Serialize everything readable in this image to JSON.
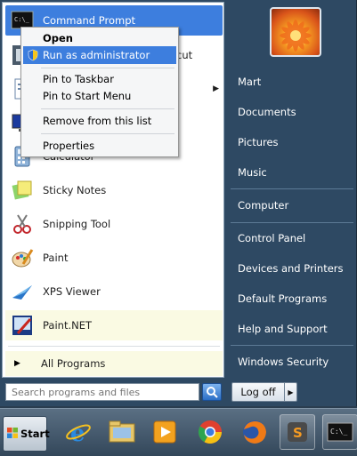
{
  "programs": [
    {
      "label": "Command Prompt",
      "icon": "command-prompt-icon"
    },
    {
      "label": "cut",
      "icon": "shortcut-icon"
    },
    {
      "label": "",
      "icon": "document-icon"
    },
    {
      "label": "",
      "icon": "monitor-icon"
    },
    {
      "label": "Calculator",
      "icon": "calculator-icon"
    },
    {
      "label": "Sticky Notes",
      "icon": "sticky-notes-icon"
    },
    {
      "label": "Snipping Tool",
      "icon": "snipping-tool-icon"
    },
    {
      "label": "Paint",
      "icon": "paint-icon"
    },
    {
      "label": "XPS Viewer",
      "icon": "xps-viewer-icon"
    },
    {
      "label": "Paint.NET",
      "icon": "paintnet-icon"
    }
  ],
  "all_programs": "All Programs",
  "search": {
    "placeholder": "Search programs and files"
  },
  "right": {
    "items": [
      "Mart",
      "Documents",
      "Pictures",
      "Music",
      "Computer",
      "Control Panel",
      "Devices and Printers",
      "Default Programs",
      "Help and Support",
      "Windows Security"
    ]
  },
  "log_off": "Log off",
  "context_menu": {
    "items": [
      "Open",
      "Run as administrator",
      "Pin to Taskbar",
      "Pin to Start Menu",
      "Remove from this list",
      "Properties"
    ]
  },
  "taskbar": {
    "start_label": "Start",
    "apps": [
      "internet-explorer-icon",
      "windows-explorer-icon",
      "media-player-icon",
      "chrome-icon",
      "firefox-icon",
      "sublime-text-icon",
      "command-prompt-icon"
    ]
  },
  "colors": {
    "selection": "#3d7ede",
    "pinned": "#fafae3",
    "menu_dark": "#2e4963"
  }
}
